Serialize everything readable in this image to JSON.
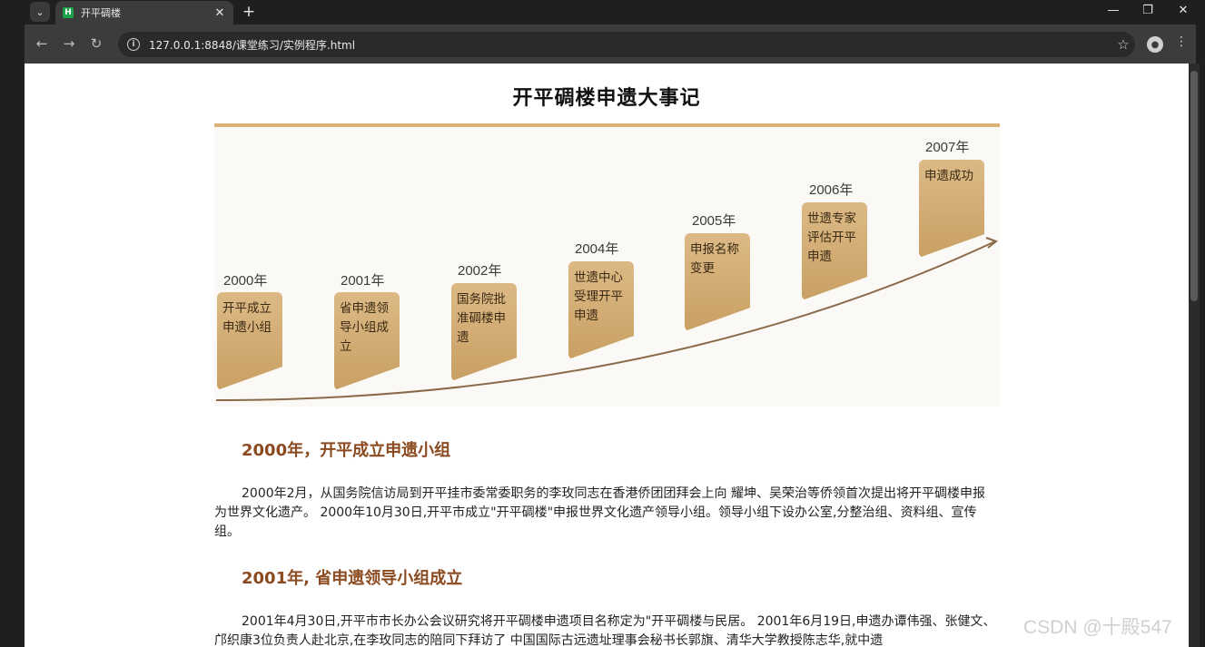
{
  "browser": {
    "tab_title": "开平碉楼",
    "favicon_letter": "H",
    "url": "127.0.0.1:8848/课堂练习/实例程序.html"
  },
  "page": {
    "title": "开平碉楼申遗大事记",
    "timeline": [
      {
        "year": "2000年",
        "event": "开平成立申遗小组"
      },
      {
        "year": "2001年",
        "event": "省申遗领导小组成立"
      },
      {
        "year": "2002年",
        "event": "国务院批准碉楼申遗"
      },
      {
        "year": "2004年",
        "event": "世遗中心受理开平申遗"
      },
      {
        "year": "2005年",
        "event": "申报名称变更"
      },
      {
        "year": "2006年",
        "event": "世遗专家评估开平申遗"
      },
      {
        "year": "2007年",
        "event": "申遗成功"
      }
    ],
    "sections": [
      {
        "heading": "2000年，开平成立申遗小组",
        "text": "2000年2月，从国务院信访局到开平挂市委常委职务的李玫同志在香港侨团团拜会上向 耀坤、吴荣治等侨领首次提出将开平碉楼申报为世界文化遗产。 2000年10月30日,开平市成立\"开平碉楼\"申报世界文化遗产领导小组。领导小组下设办公室,分整治组、资料组、宣传组。"
      },
      {
        "heading": "2001年, 省申遗领导小组成立",
        "text": "2001年4月30日,开平市市长办公会议研究将开平碉楼申遗项目名称定为\"开平碉楼与民居。 2001年6月19日,申遗办谭伟强、张健文、邝织康3位负责人赴北京,在李玫同志的陪同下拜访了 中国国际古远遗址理事会秘书长郭旗、清华大学教授陈志华,就中遗"
      }
    ]
  },
  "watermark": "CSDN @十殿547"
}
